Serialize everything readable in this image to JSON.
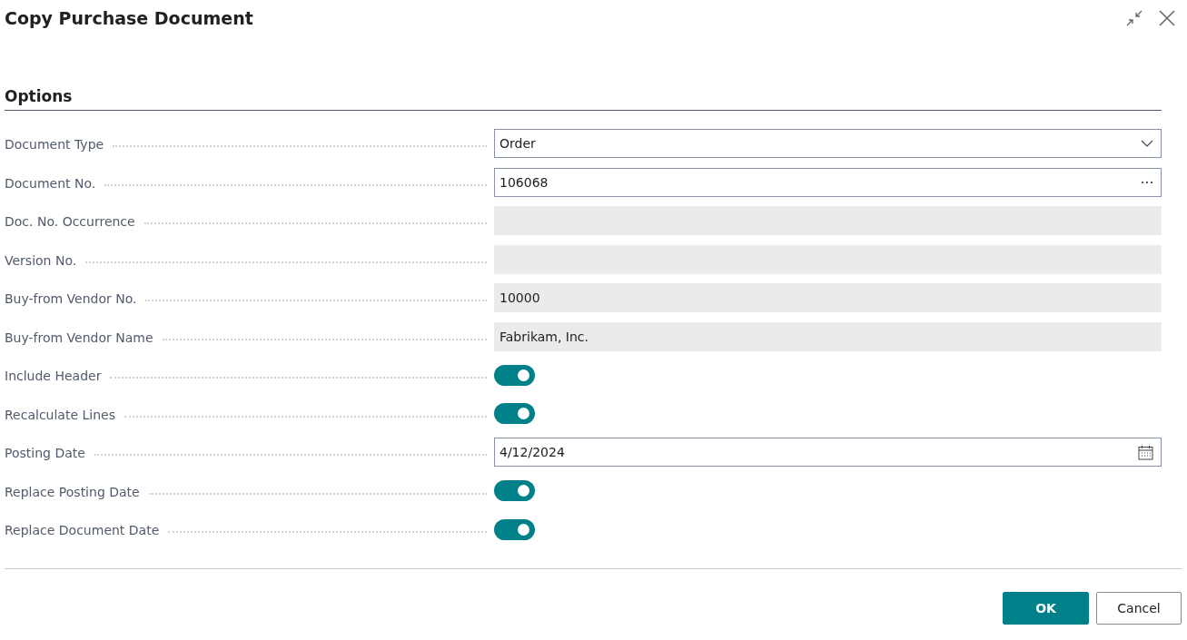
{
  "window": {
    "title": "Copy Purchase Document"
  },
  "section": {
    "title": "Options"
  },
  "fields": [
    {
      "label": "Document Type",
      "kind": "dropdown",
      "value": "Order"
    },
    {
      "label": "Document No.",
      "kind": "lookup",
      "value": "106068"
    },
    {
      "label": "Doc. No. Occurrence",
      "kind": "readonly"
    },
    {
      "label": "Version No.",
      "kind": "readonly"
    },
    {
      "label": "Buy-from Vendor No.",
      "kind": "readonly",
      "value": "10000"
    },
    {
      "label": "Buy-from Vendor Name",
      "kind": "readonly",
      "value": "Fabrikam, Inc."
    },
    {
      "label": "Include Header",
      "kind": "toggle",
      "on": true
    },
    {
      "label": "Recalculate Lines",
      "kind": "toggle",
      "on": true
    },
    {
      "label": "Posting Date",
      "kind": "date",
      "value": "4/12/2024"
    },
    {
      "label": "Replace Posting Date",
      "kind": "toggle",
      "on": true
    },
    {
      "label": "Replace Document Date",
      "kind": "toggle",
      "on": true
    }
  ],
  "buttons": [
    {
      "label": "OK",
      "kind": "primary"
    },
    {
      "label": "Cancel",
      "kind": "secondary"
    }
  ]
}
